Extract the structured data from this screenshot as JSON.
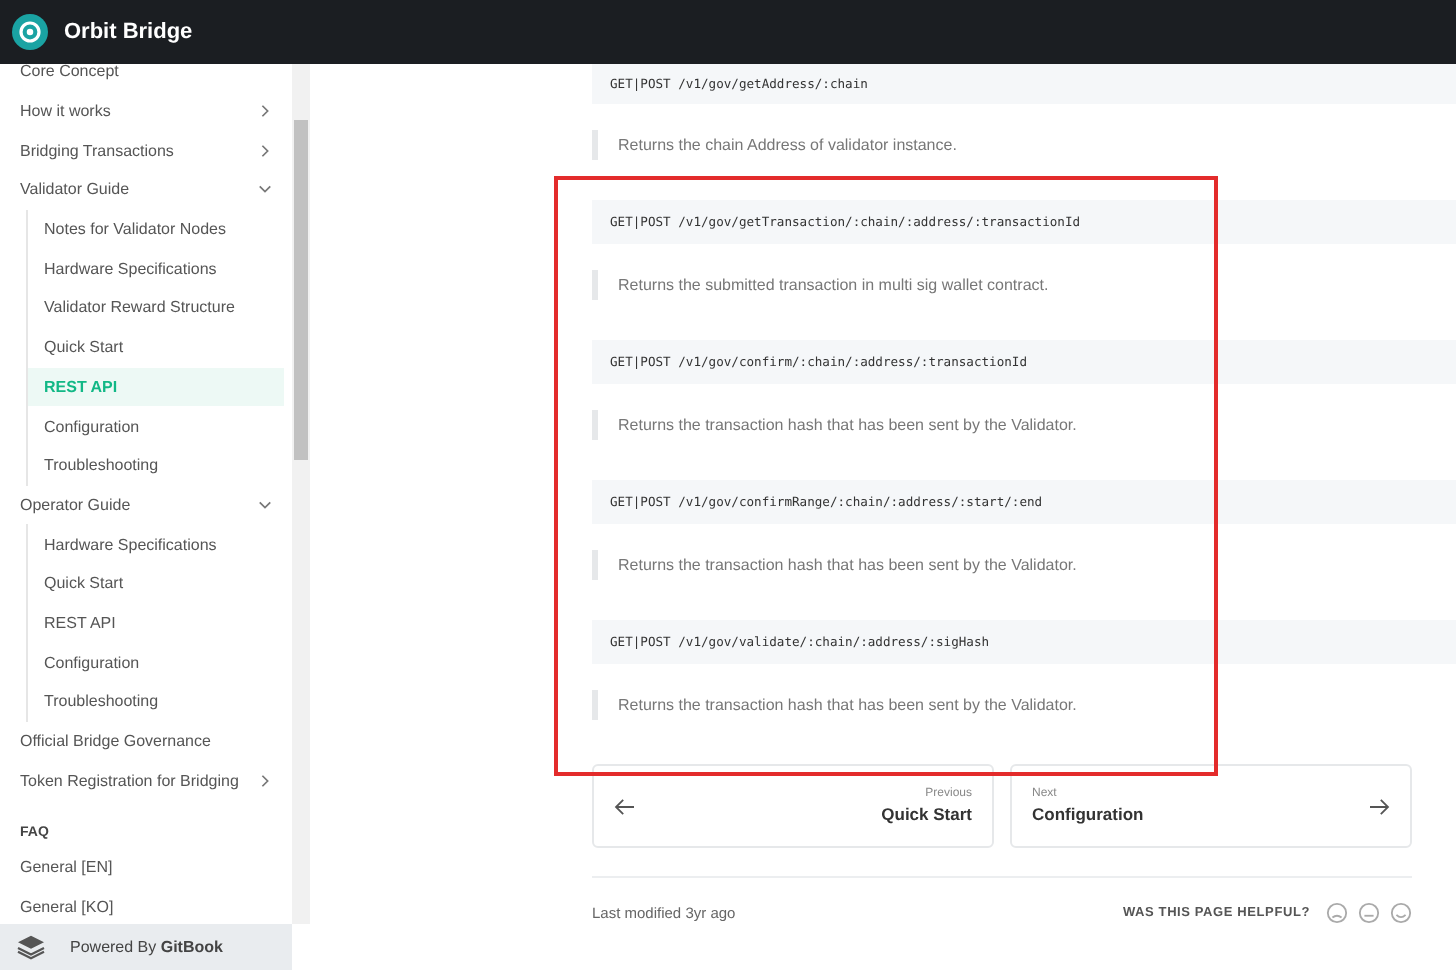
{
  "header": {
    "title": "Orbit Bridge"
  },
  "sidebar": {
    "items": [
      {
        "label": "Core Concept",
        "selected": false
      },
      {
        "label": "How it works",
        "selected": false,
        "expanded": false
      },
      {
        "label": "Bridging Transactions",
        "selected": false,
        "expanded": false
      },
      {
        "label": "Validator Guide",
        "selected": false,
        "expanded": true,
        "children": [
          {
            "label": "Notes for Validator Nodes",
            "selected": false
          },
          {
            "label": "Hardware Specifications",
            "selected": false
          },
          {
            "label": "Validator Reward Structure",
            "selected": false
          },
          {
            "label": "Quick Start",
            "selected": false
          },
          {
            "label": "REST API",
            "selected": true
          },
          {
            "label": "Configuration",
            "selected": false
          },
          {
            "label": "Troubleshooting",
            "selected": false
          }
        ]
      },
      {
        "label": "Operator Guide",
        "selected": false,
        "expanded": true,
        "children": [
          {
            "label": "Hardware Specifications",
            "selected": false
          },
          {
            "label": "Quick Start",
            "selected": false
          },
          {
            "label": "REST API",
            "selected": false
          },
          {
            "label": "Configuration",
            "selected": false
          },
          {
            "label": "Troubleshooting",
            "selected": false
          }
        ]
      },
      {
        "label": "Official Bridge Governance",
        "selected": false
      },
      {
        "label": "Token Registration for Bridging",
        "selected": false,
        "expanded": false
      }
    ],
    "section_heading": "FAQ",
    "faq_items": [
      {
        "label": "General [EN]",
        "selected": false
      },
      {
        "label": "General [KO]",
        "selected": false
      }
    ],
    "footer": "Powered By **GitBook**"
  },
  "endpoints": [
    {
      "route": "GET|POST /v1/gov/getAddress/:chain",
      "description": "Returns the chain Address of validator instance."
    },
    {
      "route": "GET|POST /v1/gov/getTransaction/:chain/:address/:transactionId",
      "description": "Returns the submitted transaction in multi sig wallet contract."
    },
    {
      "route": "GET|POST /v1/gov/confirm/:chain/:address/:transactionId",
      "description": "Returns the transaction hash that has been sent by the Validator."
    },
    {
      "route": "GET|POST /v1/gov/confirmRange/:chain/:address/:start/:end",
      "description": "Returns the transaction hash that has been sent by the Validator."
    },
    {
      "route": "GET|POST /v1/gov/validate/:chain/:address/:sigHash",
      "description": "Returns the transaction hash that has been sent by the Validator."
    }
  ],
  "pagination": {
    "previous": {
      "label": "Previous",
      "title": "Quick Start"
    },
    "next": {
      "label": "Next",
      "title": "Configuration"
    }
  },
  "last_modified": "Last modified 3yr ago",
  "feedback": {
    "question": "WAS THIS PAGE HELPFUL?"
  }
}
